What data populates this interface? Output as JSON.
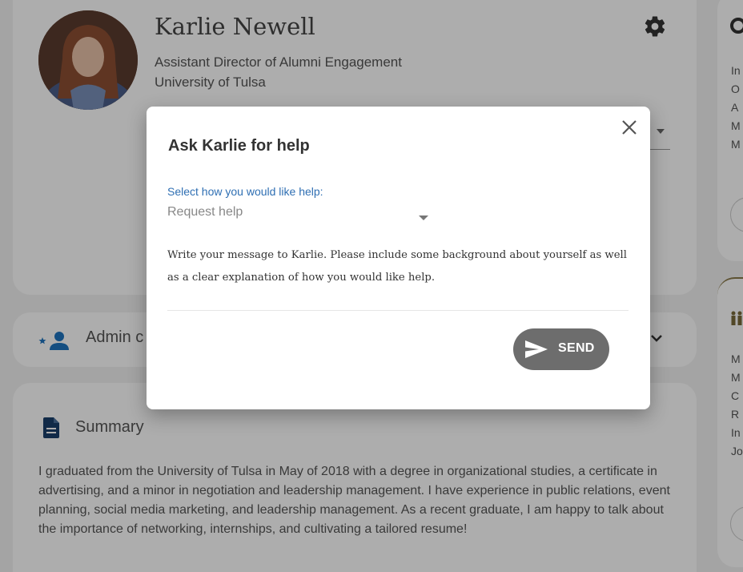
{
  "profile": {
    "name": "Karlie Newell",
    "job_title": "Assistant Director of Alumni Engagement",
    "organization": "University of Tulsa"
  },
  "admin_section": {
    "label_visible": "Admin c"
  },
  "summary": {
    "title": "Summary",
    "text": "I graduated from the University of Tulsa in May of 2018 with a degree in organizational studies, a certificate in advertising, and a minor in negotiation and leadership management. I have experience in public relations, event planning, social media marketing, and leadership management. As a recent graduate, I am happy to talk about the importance of networking, internships, and cultivating a tailored resume!"
  },
  "right_panel": {
    "upper_letters": [
      "In",
      "O",
      "A",
      "M",
      "M"
    ],
    "lower_letters": [
      "M",
      "M",
      "C",
      "R",
      "In",
      "Jo"
    ]
  },
  "modal": {
    "title": "Ask Karlie for help",
    "select_label": "Select how you would like help:",
    "select_value": "Request help",
    "message_placeholder": "Write your message to Karlie. Please include some background about yourself as well as a clear explanation of how you would like help.",
    "send_label": "SEND"
  },
  "icons": {
    "settings": "gear-icon",
    "admin": "person-star-icon",
    "summary": "document-icon",
    "close": "close-icon",
    "send": "send-icon",
    "dropdown": "caret-down-icon"
  },
  "colors": {
    "select_label": "#2f6fb3",
    "send_button": "#6d6d6d",
    "icon_dark": "#333333",
    "side_accent": "#8a7a4a"
  }
}
